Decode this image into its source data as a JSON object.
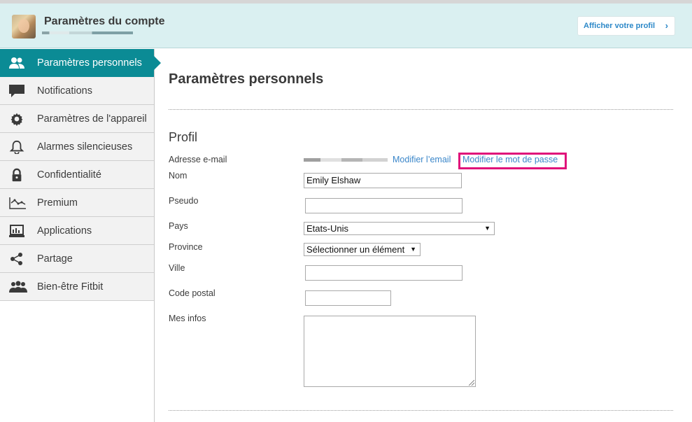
{
  "header": {
    "title": "Paramètres du compte",
    "profile_button": "Afficher votre profil",
    "profile_button_icon": "chevron-right-icon"
  },
  "sidebar": {
    "items": [
      {
        "label": "Paramètres personnels",
        "icon": "users-icon",
        "active": true
      },
      {
        "label": "Notifications",
        "icon": "speech-bubble-icon",
        "active": false
      },
      {
        "label": "Paramètres de l'appareil",
        "icon": "gear-icon",
        "active": false
      },
      {
        "label": "Alarmes silencieuses",
        "icon": "bell-icon",
        "active": false
      },
      {
        "label": "Confidentialité",
        "icon": "lock-icon",
        "active": false
      },
      {
        "label": "Premium",
        "icon": "line-chart-icon",
        "active": false
      },
      {
        "label": "Applications",
        "icon": "monitor-icon",
        "active": false
      },
      {
        "label": "Partage",
        "icon": "share-icon",
        "active": false
      },
      {
        "label": "Bien-être Fitbit",
        "icon": "group-icon",
        "active": false
      }
    ]
  },
  "main": {
    "title": "Paramètres personnels",
    "section_title": "Profil",
    "labels": {
      "email": "Adresse e-mail",
      "name": "Nom",
      "nickname": "Pseudo",
      "country": "Pays",
      "province": "Province",
      "city": "Ville",
      "postal": "Code postal",
      "about": "Mes infos"
    },
    "links": {
      "change_email": "Modifier l’email",
      "change_password": "Modifier le mot de passe"
    },
    "fields": {
      "name": "Emily Elshaw",
      "nickname": "",
      "country": "Etats-Unis",
      "province": "Sélectionner un élément",
      "city": "",
      "postal": "",
      "about": ""
    },
    "colors": {
      "accent": "#0b8b95",
      "header_bg": "#daf0f1",
      "link": "#3a86c9",
      "highlight": "#e0127a"
    }
  }
}
